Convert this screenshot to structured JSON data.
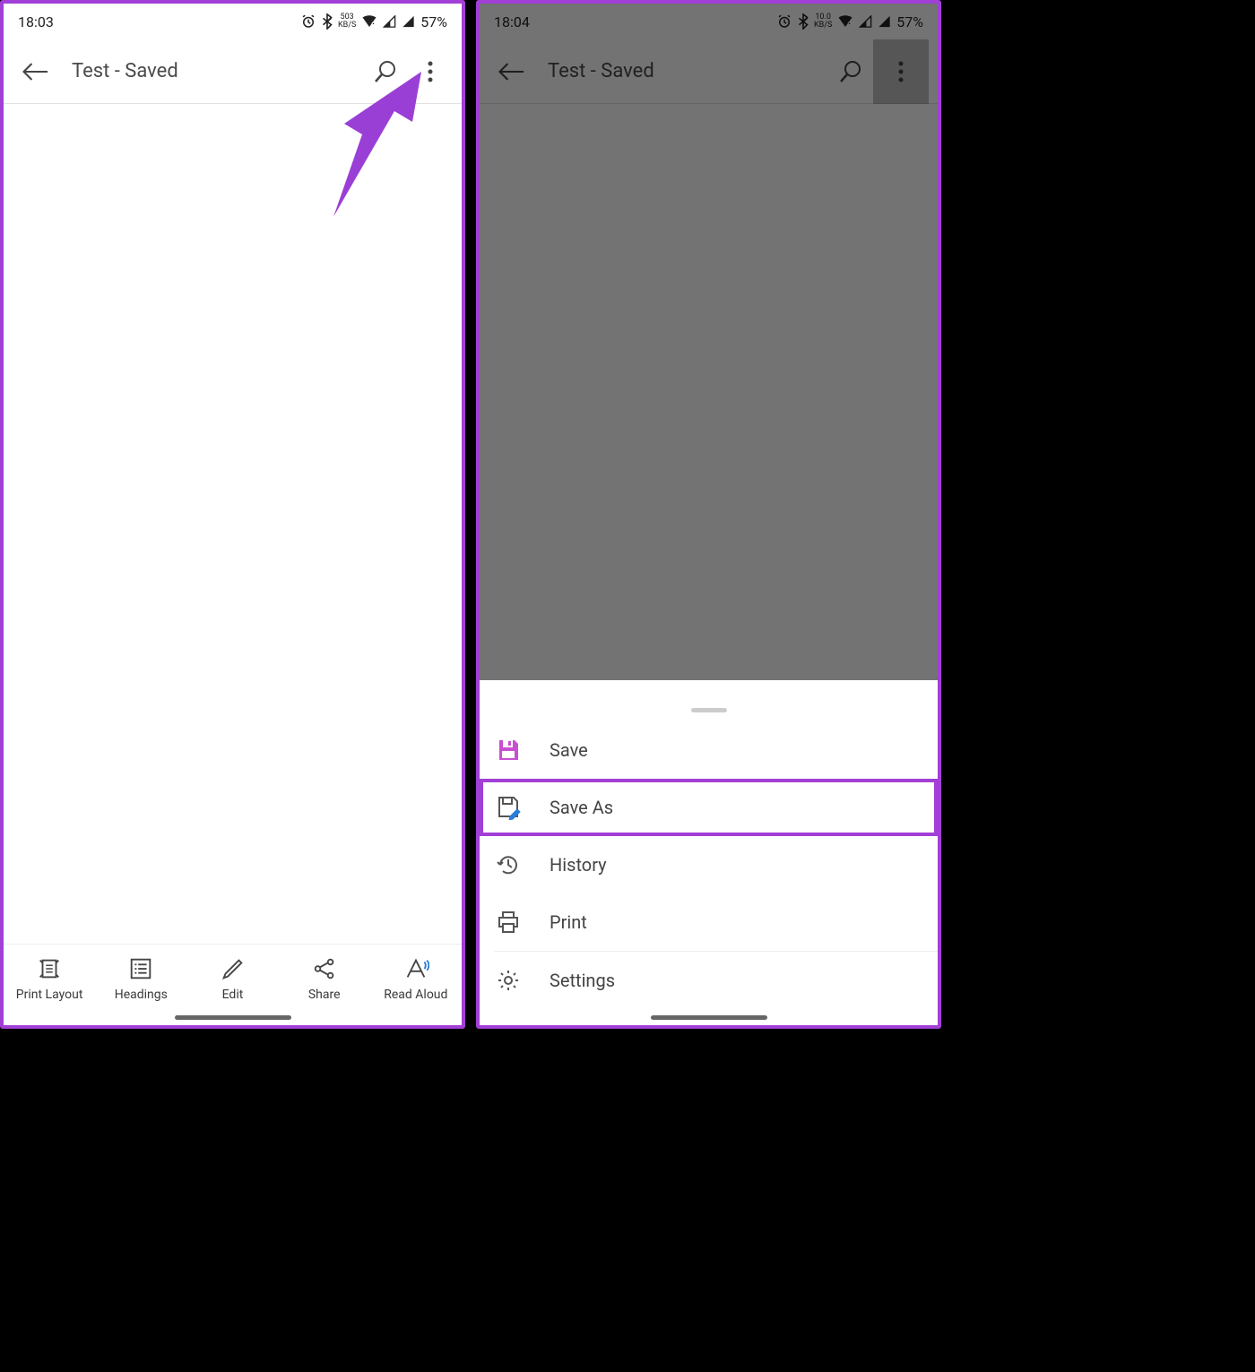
{
  "left": {
    "statusbar": {
      "time": "18:03",
      "speed_top": "503",
      "speed_bot": "KB/S",
      "battery": "57%"
    },
    "header": {
      "title": "Test - Saved"
    },
    "bottombar": {
      "items": [
        {
          "label": "Print Layout",
          "icon": "print-layout-icon"
        },
        {
          "label": "Headings",
          "icon": "headings-icon"
        },
        {
          "label": "Edit",
          "icon": "edit-icon"
        },
        {
          "label": "Share",
          "icon": "share-icon"
        },
        {
          "label": "Read Aloud",
          "icon": "read-aloud-icon"
        }
      ]
    },
    "colors": {
      "accent": "#a23fd6"
    }
  },
  "right": {
    "statusbar": {
      "time": "18:04",
      "speed_top": "10.0",
      "speed_bot": "KB/S",
      "battery": "57%"
    },
    "header": {
      "title": "Test - Saved"
    },
    "sheet": {
      "items": [
        {
          "label": "Save",
          "icon": "save-icon",
          "highlighted_icon_color": "#c94fd1"
        },
        {
          "label": "Save As",
          "icon": "save-as-icon",
          "highlighted": true
        },
        {
          "label": "History",
          "icon": "history-icon"
        },
        {
          "label": "Print",
          "icon": "print-icon"
        },
        {
          "label": "Settings",
          "icon": "settings-icon"
        }
      ]
    }
  }
}
